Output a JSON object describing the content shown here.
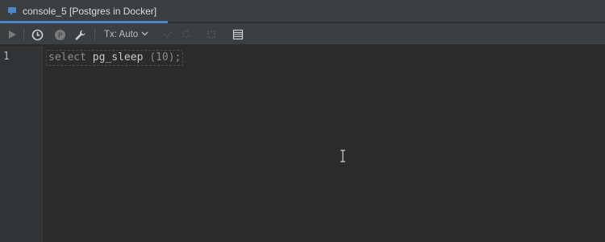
{
  "tab": {
    "title": "console_5 [Postgres in Docker]",
    "icon": "database-console-icon",
    "accent": "#4a88c7"
  },
  "toolbar": {
    "tx_label": "Tx: Auto",
    "icons": [
      "execute-icon",
      "history-icon",
      "parameters-icon",
      "settings-icon",
      "commit-icon",
      "rollback-icon",
      "cancel-icon",
      "output-layout-icon"
    ]
  },
  "editor": {
    "line_numbers": [
      "1"
    ],
    "code": {
      "keyword": "select",
      "function": "pg_sleep",
      "open": "(",
      "arg": "10",
      "close": ");"
    }
  },
  "colors": {
    "background": "#2b2b2b",
    "panel": "#3c3f41",
    "gutter": "#313335",
    "text": "#a9b7c6"
  }
}
